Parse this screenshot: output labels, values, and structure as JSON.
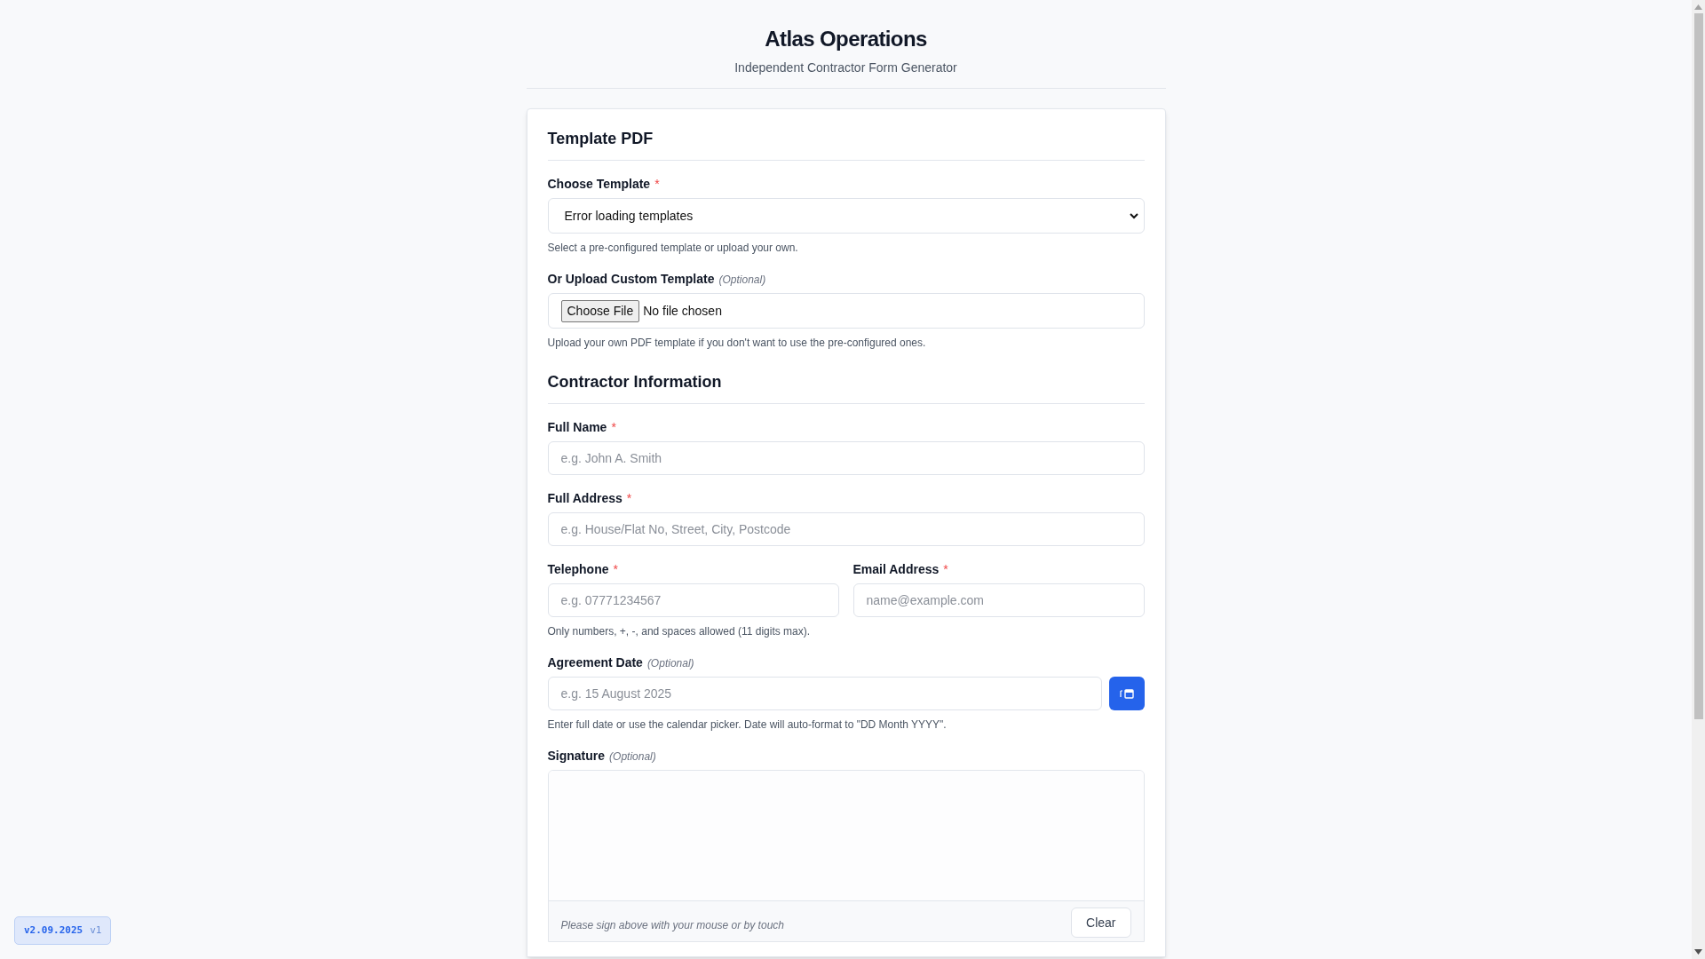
{
  "header": {
    "title": "Atlas Operations",
    "subtitle": "Independent Contractor Form Generator"
  },
  "sections": [
    {
      "title": "Template PDF",
      "fields": [
        {
          "kind": "select",
          "label": "Choose Template",
          "required_mark": "*",
          "value": "Error loading templates",
          "help": "Select a pre-configured template or upload your own."
        },
        {
          "kind": "file",
          "label": "Or Upload Custom Template",
          "note": "(Optional)",
          "button": "Choose File",
          "status": "No file chosen",
          "help": "Upload your own PDF template if you don't want to use the pre-configured ones."
        }
      ]
    },
    {
      "title": "Contractor Information",
      "fields": [
        {
          "kind": "text",
          "label": "Full Name",
          "required_mark": "*",
          "placeholder": "e.g. John A. Smith"
        },
        {
          "kind": "text",
          "label": "Full Address",
          "required_mark": "*",
          "placeholder": "e.g. House/Flat No, Street, City, Postcode"
        },
        {
          "kind": "pair",
          "items": [
            {
              "label": "Telephone",
              "required_mark": "*",
              "placeholder": "e.g. 07771234567"
            },
            {
              "label": "Email Address",
              "required_mark": "*",
              "placeholder": "name@example.com"
            }
          ],
          "help": "Only numbers, +, -, and spaces allowed (11 digits max)."
        },
        {
          "kind": "date",
          "label": "Agreement Date",
          "note": "(Optional)",
          "placeholder": "e.g. 15 August 2025",
          "help": "Enter full date or use the calendar picker. Date will auto-format to \"DD Month YYYY\"."
        },
        {
          "kind": "signature",
          "label": "Signature",
          "note": "(Optional)",
          "hint": "Please sign above with your mouse or by touch",
          "button": "Clear"
        }
      ]
    }
  ],
  "version_badge": {
    "version": "v2.09.2025",
    "build": "v1"
  }
}
